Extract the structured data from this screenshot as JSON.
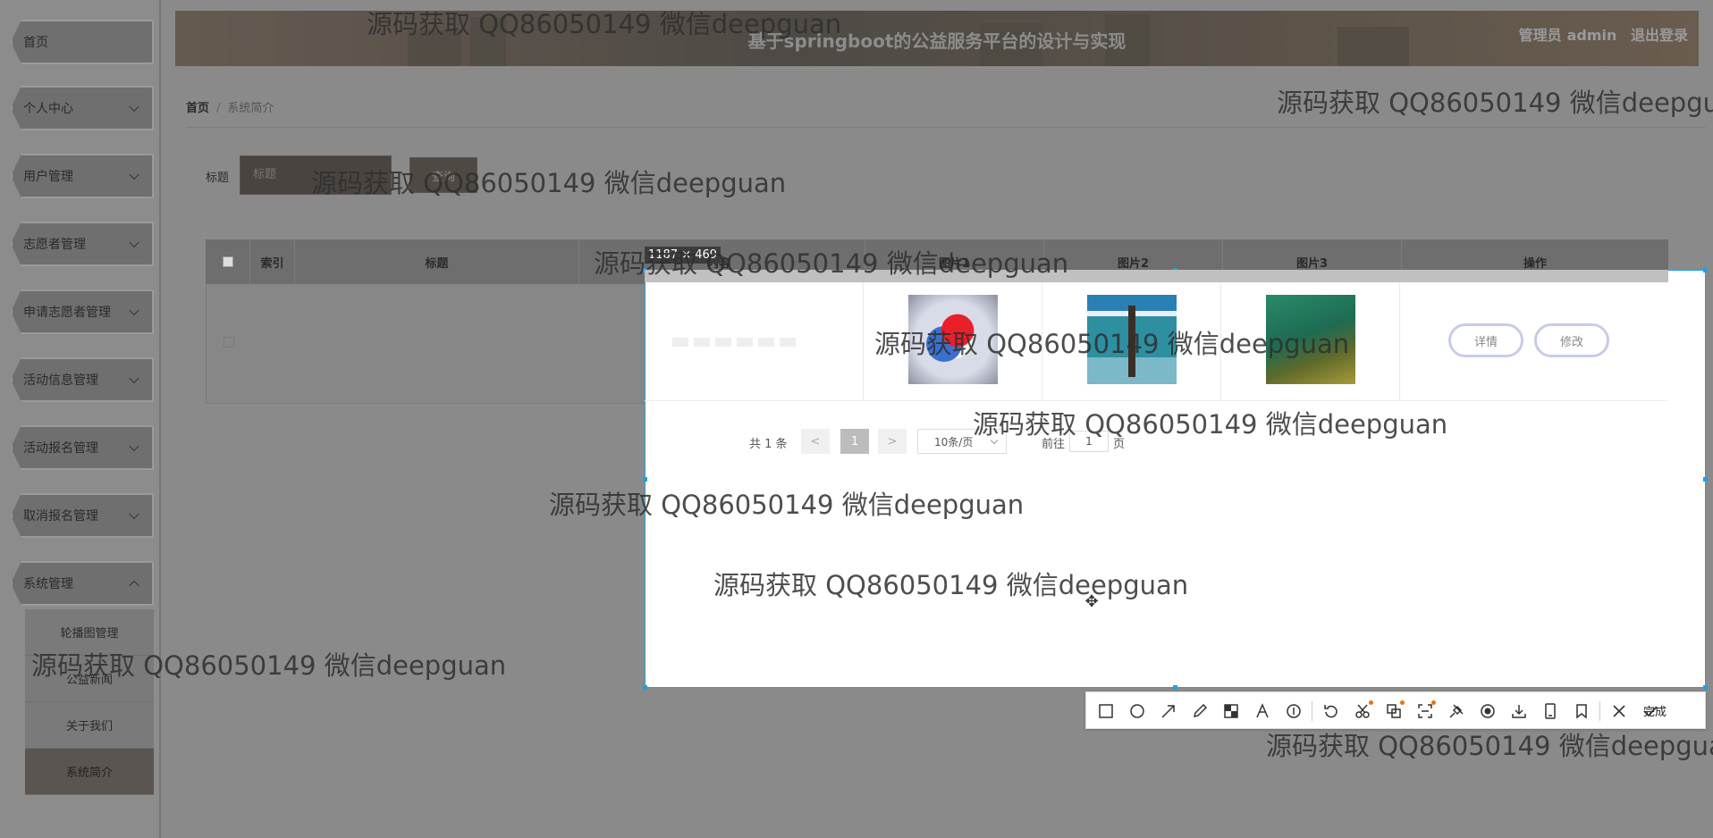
{
  "app": {
    "title": "基于springboot的公益服务平台的设计与实现"
  },
  "header": {
    "role": "管理员",
    "username": "admin",
    "logout": "退出登录"
  },
  "sidebar": {
    "items": [
      {
        "label": "首页"
      },
      {
        "label": "个人中心"
      },
      {
        "label": "用户管理"
      },
      {
        "label": "志愿者管理"
      },
      {
        "label": "申请志愿者管理"
      },
      {
        "label": "活动信息管理"
      },
      {
        "label": "活动报名管理"
      },
      {
        "label": "取消报名管理"
      },
      {
        "label": "系统管理"
      }
    ],
    "submenu": [
      {
        "label": "轮播图管理"
      },
      {
        "label": "公益新闻"
      },
      {
        "label": "关于我们"
      },
      {
        "label": "系统简介"
      }
    ]
  },
  "breadcrumb": {
    "home": "首页",
    "separator": "/",
    "current": "系统简介"
  },
  "search": {
    "label": "标题",
    "placeholder": "标题",
    "button": "查询"
  },
  "table": {
    "columns": [
      "索引",
      "标题",
      "图片1",
      "图片2",
      "图片3",
      "操作"
    ],
    "partial_header": "内容",
    "row": {
      "detail": "详情",
      "edit": "修改"
    }
  },
  "pagination": {
    "total": "共 1 条",
    "prev": "<",
    "page": "1",
    "next": ">",
    "page_size": "10条/页",
    "goto": "前往",
    "goto_value": "1",
    "goto_suffix": "页"
  },
  "screenshot_tool": {
    "size": "1187 × 469",
    "done": "完成",
    "icons": [
      "rect-icon",
      "circle-icon",
      "arrow-icon",
      "pen-icon",
      "mosaic-icon",
      "text-icon",
      "number-icon",
      "undo-icon",
      "scissors-icon",
      "translate-icon",
      "ocr-icon",
      "pin-icon",
      "record-icon",
      "download-icon",
      "mobile-icon",
      "bookmark-icon",
      "close-icon",
      "check-icon"
    ]
  },
  "watermark": "源码获取 QQ86050149 微信deepguan",
  "colors": {
    "selection_border": "#1ea0e6",
    "button_border": "#c8cbe8"
  }
}
